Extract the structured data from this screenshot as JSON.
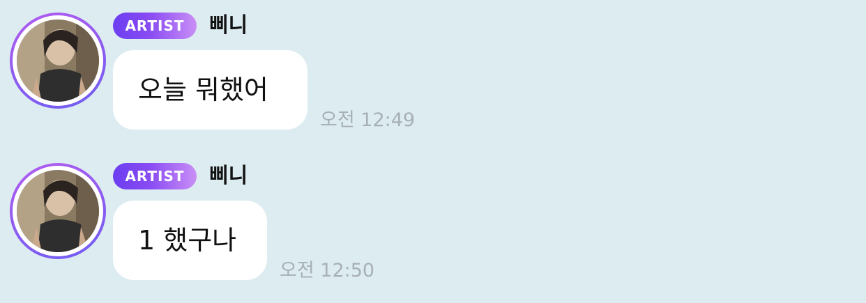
{
  "messages": [
    {
      "badge": "ARTIST",
      "sender": "삐니",
      "text": "오늘 뭐했어",
      "time": "오전 12:49"
    },
    {
      "badge": "ARTIST",
      "sender": "삐니",
      "text": "1 했구나",
      "time": "오전 12:50"
    }
  ],
  "colors": {
    "background": "#dcecf1",
    "bubble": "#ffffff",
    "badge_start": "#6b3ef0",
    "badge_end": "#c98ff5",
    "avatar_ring": "#8f5cf0",
    "time_text": "#a7b0b5"
  }
}
